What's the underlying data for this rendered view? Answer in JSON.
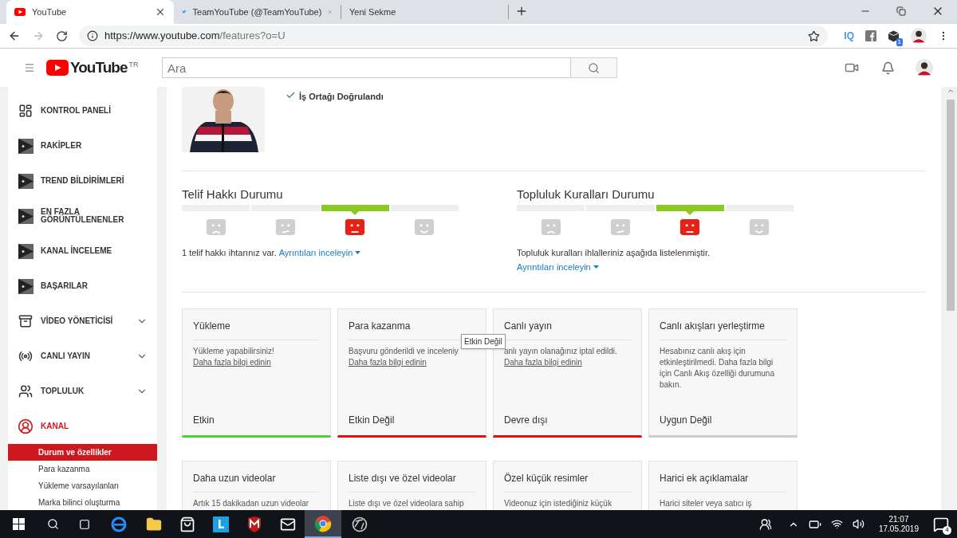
{
  "browser": {
    "tabs": [
      {
        "title": "YouTube",
        "kind": "youtube",
        "selected": true
      },
      {
        "title": "TeamYouTube (@TeamYouTube)",
        "kind": "twitter",
        "selected": false
      },
      {
        "title": "Yeni Sekme",
        "kind": "blank",
        "selected": false
      }
    ],
    "url_host": "https://www.youtube.com",
    "url_path": "/features?o=U",
    "ext_iq": "IQ",
    "ext_badge": "1"
  },
  "header": {
    "logo": "YouTube",
    "region": "TR",
    "search": {
      "placeholder": "Ara"
    }
  },
  "sidebar": {
    "items": [
      {
        "label": "KONTROL PANELİ",
        "kind": "dashboard",
        "expandable": false,
        "selected": false
      },
      {
        "label": "RAKİPLER",
        "kind": "iq",
        "expandable": false,
        "selected": false
      },
      {
        "label": "TREND BİLDİRİMLERİ",
        "kind": "iq",
        "expandable": false,
        "selected": false
      },
      {
        "label": "EN FAZLA GÖRÜNTÜLENENLER",
        "kind": "iq",
        "expandable": false,
        "selected": false
      },
      {
        "label": "KANAL İNCELEME",
        "kind": "iq",
        "expandable": false,
        "selected": false
      },
      {
        "label": "BAŞARILAR",
        "kind": "iq",
        "expandable": false,
        "selected": false
      },
      {
        "label": "VİDEO YÖNETİCİSİ",
        "kind": "videos",
        "expandable": true,
        "selected": false
      },
      {
        "label": "CANLI YAYIN",
        "kind": "live",
        "expandable": true,
        "selected": false
      },
      {
        "label": "TOPLULUK",
        "kind": "people",
        "expandable": true,
        "selected": false
      },
      {
        "label": "KANAL",
        "kind": "account",
        "expandable": false,
        "selected": true
      }
    ],
    "subitems": [
      {
        "label": "Durum ve özellikler",
        "selected": true
      },
      {
        "label": "Para kazanma",
        "selected": false
      },
      {
        "label": "Yükleme varsayılanları",
        "selected": false
      },
      {
        "label": "Marka bilinci oluşturma",
        "selected": false
      }
    ]
  },
  "profile": {
    "verified": "İş Ortağı Doğrulandı"
  },
  "statuses": [
    {
      "title": "Telif Hakkı Durumu",
      "segments": [
        {
          "kind": "sad",
          "selected": false
        },
        {
          "kind": "meh",
          "selected": false
        },
        {
          "kind": "flat",
          "selected": true
        },
        {
          "kind": "happy",
          "selected": false
        }
      ],
      "text": "1 telif hakkı ihtarınız var.",
      "link": "Ayrıntıları inceleyin"
    },
    {
      "title": "Topluluk Kuralları Durumu",
      "segments": [
        {
          "kind": "sad",
          "selected": false
        },
        {
          "kind": "meh",
          "selected": false
        },
        {
          "kind": "flat",
          "selected": true
        },
        {
          "kind": "happy",
          "selected": false
        }
      ],
      "text": "Topluluk kuralları ihlalleriniz aşağıda listelenmiştir.",
      "link": "Ayrıntıları inceleyin"
    }
  ],
  "cards": [
    {
      "title": "Yükleme",
      "text": "Yükleme yapabilirsiniz!",
      "link": "Daha fazla bilgi edinin",
      "status": "Etkin",
      "color": "#4cd137"
    },
    {
      "title": "Para kazanma",
      "text": "Başvuru gönderildi ve inceleniy",
      "link": "Daha fazla bilgi edinin",
      "status": "Etkin Değil",
      "color": "#dd1111"
    },
    {
      "title": "Canlı yayın",
      "text": "anlı yayın olanağınız iptal edildi.",
      "link": "Daha fazla bilgi edinin",
      "status": "Devre dışı",
      "color": "#dd1111"
    },
    {
      "title": "Canlı akışları yerleştirme",
      "text": "Hesabınız canlı akış için etkinleştirilmedi. Daha fazla bilgi için Canlı Akış özelliği durumuna bakın.",
      "status": "Uygun Değil",
      "color": "#cccccc"
    },
    {
      "title": "Daha uzun videolar",
      "text": "Artık 15 dakikadan uzun videolar"
    },
    {
      "title": "Liste dışı ve özel videolar",
      "text": "Liste dışı ve özel videolara sahip"
    },
    {
      "title": "Özel küçük resimler",
      "text": "Videonuz için istediğiniz küçük"
    },
    {
      "title": "Harici ek açıklamalar",
      "text": "Harici siteler veya satıcı iş"
    }
  ],
  "tooltip": "Etkin Değil",
  "taskbar": {
    "time": "21:07",
    "date": "17.05.2019",
    "notifications": "4"
  }
}
